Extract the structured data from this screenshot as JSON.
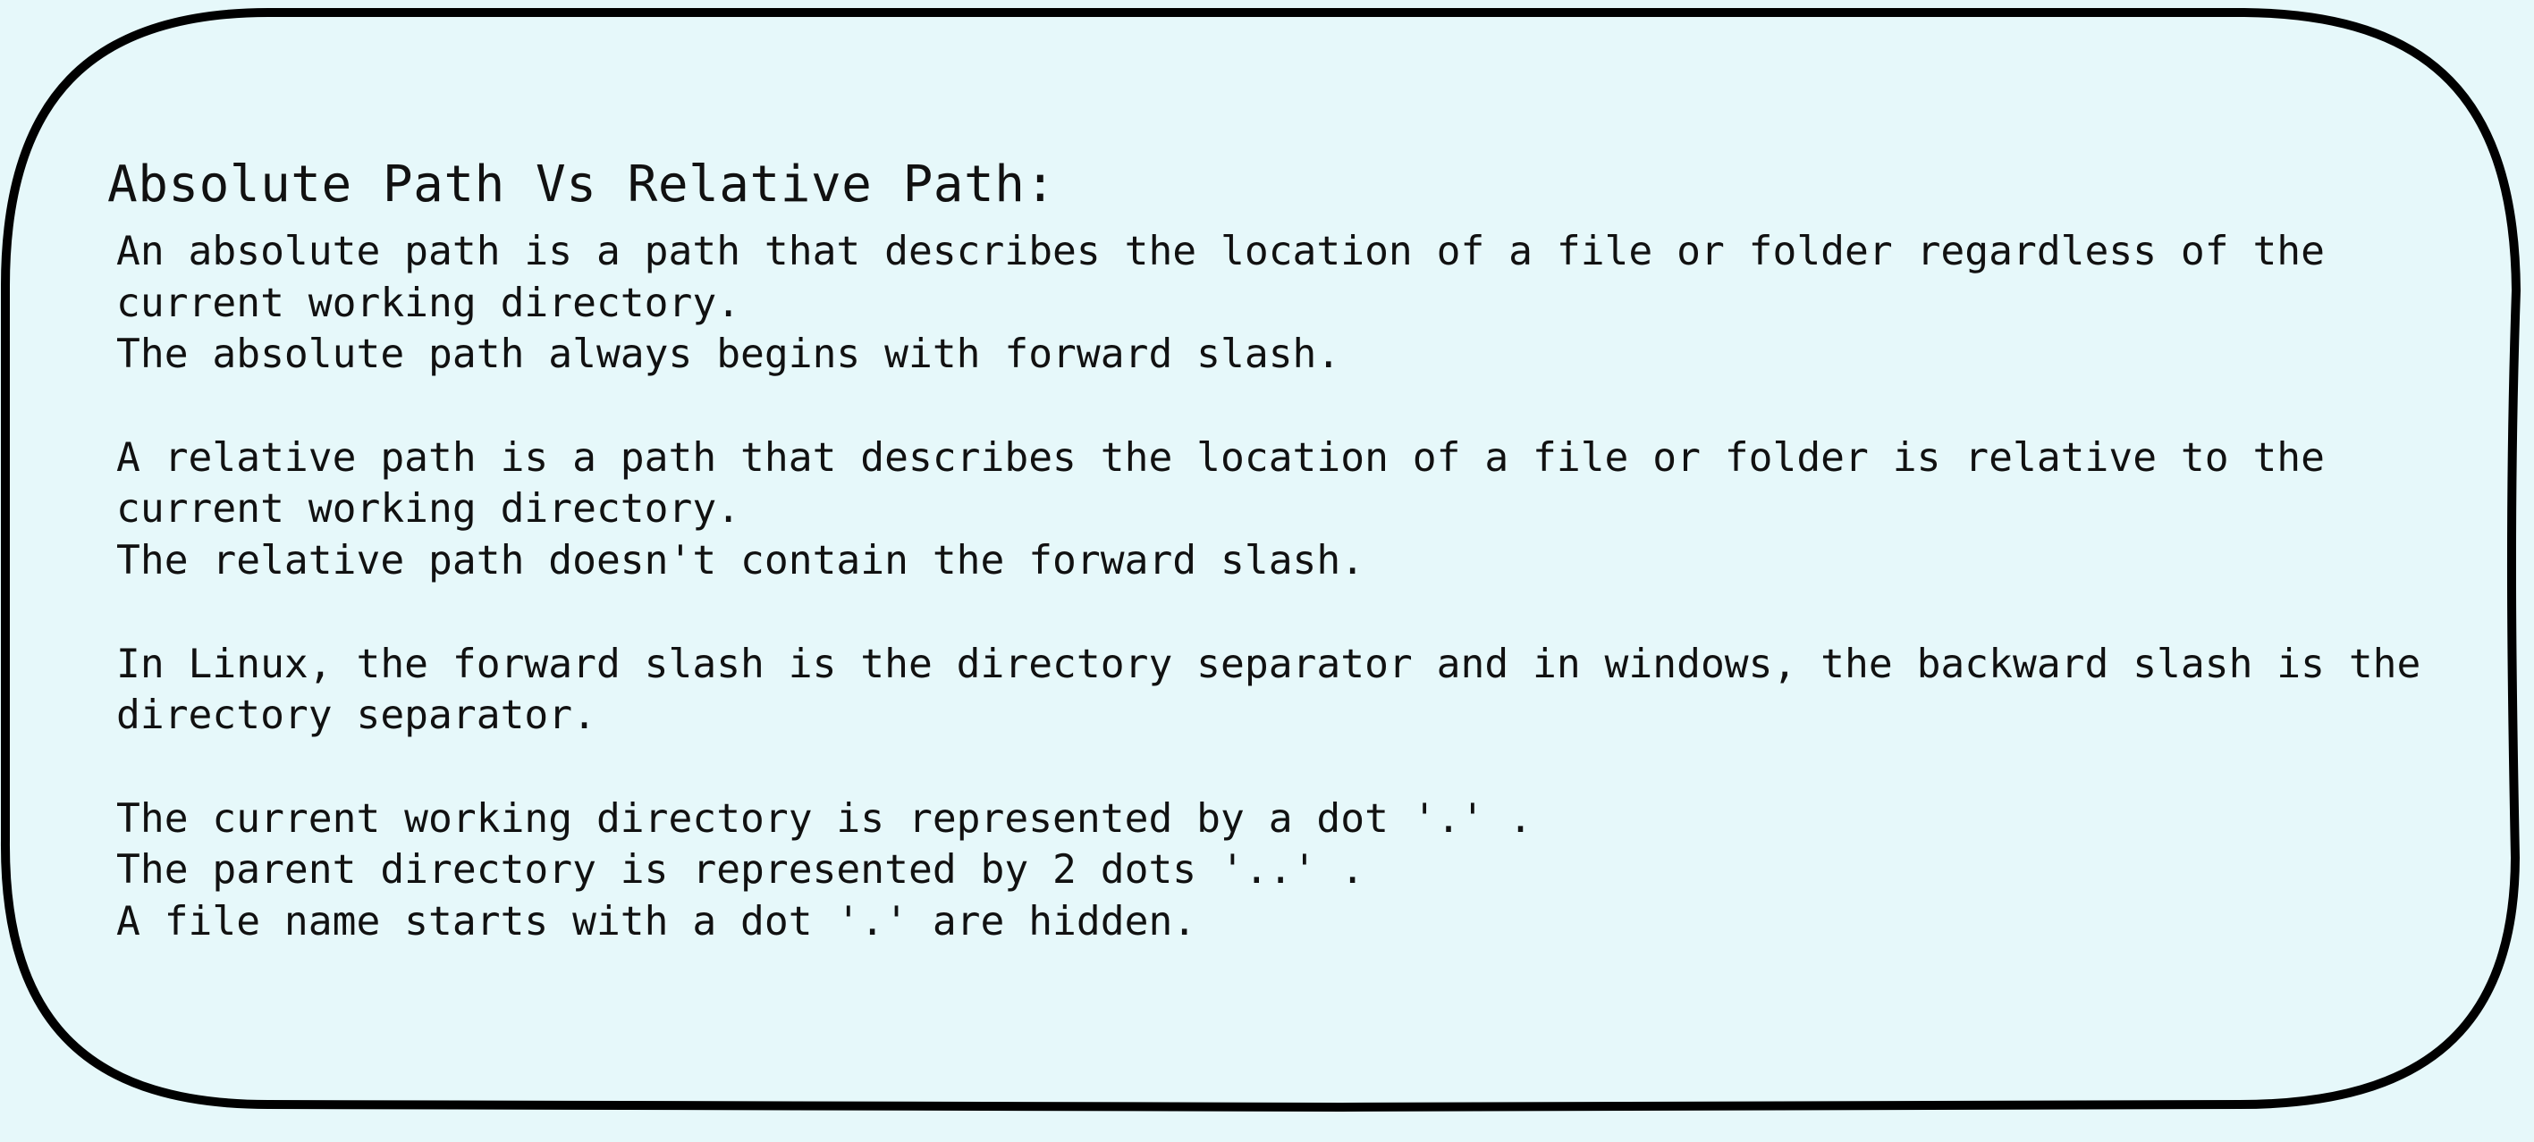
{
  "colors": {
    "background": "#e6f8fa",
    "outline": "#000000",
    "text": "#111111"
  },
  "note": {
    "title": "Absolute Path Vs Relative Path:",
    "lines": [
      "An absolute path is a path that describes the location of a file or folder regardless of the",
      "current working directory.",
      "The absolute path always begins with forward slash.",
      "",
      "A relative path is a path that describes the location of a file or folder is relative to the",
      "current working directory.",
      "The relative path doesn't contain the forward slash.",
      "",
      "In Linux, the forward slash is the directory separator and in windows, the backward slash is the",
      "directory separator.",
      "",
      "The current working directory is represented by a dot '.' .",
      "The parent directory is represented by 2 dots '..' .",
      "A file name starts with a dot '.' are hidden."
    ]
  }
}
